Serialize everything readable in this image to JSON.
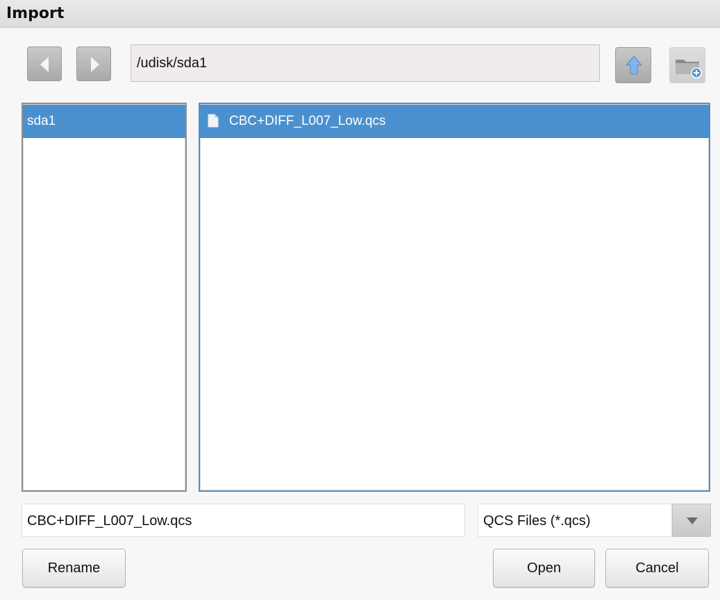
{
  "window": {
    "title": "Import"
  },
  "toolbar": {
    "back_icon": "chevron-left-icon",
    "forward_icon": "chevron-right-icon",
    "path": "/udisk/sda1",
    "up_icon": "arrow-up-icon",
    "new_folder_icon": "new-folder-icon"
  },
  "sidebar": {
    "items": [
      {
        "label": "sda1",
        "selected": true
      }
    ]
  },
  "files": {
    "items": [
      {
        "name": "CBC+DIFF_L007_Low.qcs",
        "icon": "file-icon",
        "selected": true
      }
    ]
  },
  "footer": {
    "filename": "CBC+DIFF_L007_Low.qcs",
    "filter": "QCS Files (*.qcs)",
    "rename_label": "Rename",
    "open_label": "Open",
    "cancel_label": "Cancel"
  },
  "colors": {
    "selection": "#4a90cf",
    "pane_border_active": "#5b8cc0"
  }
}
